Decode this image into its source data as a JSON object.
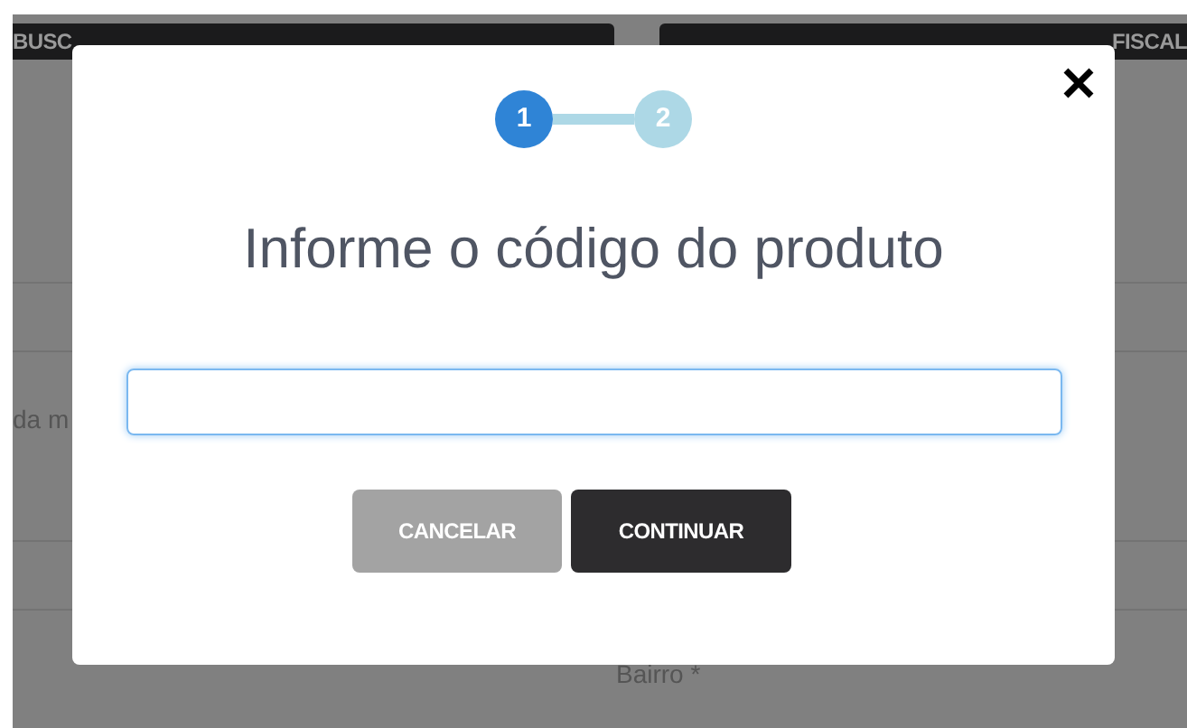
{
  "background": {
    "bars": [
      "BUSC",
      "FISCAL"
    ],
    "labels": [
      "da m",
      "Bairro *"
    ]
  },
  "modal": {
    "steps": [
      {
        "label": "1",
        "selected": true
      },
      {
        "label": "2",
        "selected": false
      }
    ],
    "title": "Informe o código do produto",
    "buttons": [
      {
        "label": "CANCELAR",
        "kind": "secondary"
      },
      {
        "label": "CONTINUAR",
        "kind": "primary"
      }
    ]
  }
}
